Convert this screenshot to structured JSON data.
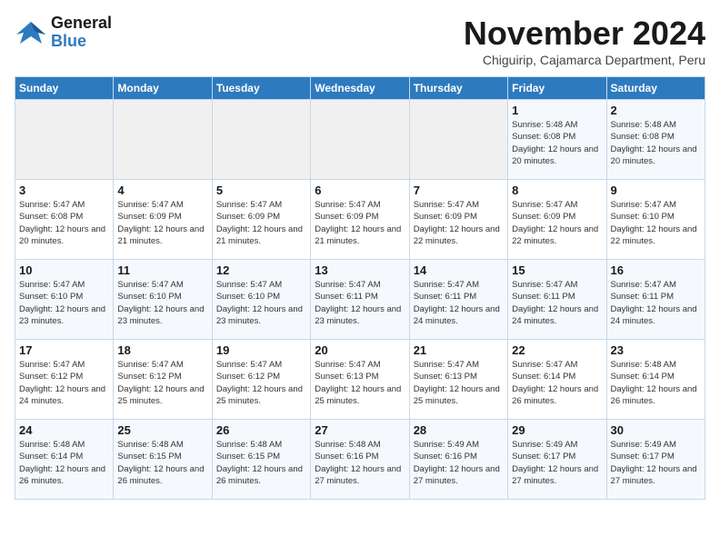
{
  "logo": {
    "line1": "General",
    "line2": "Blue"
  },
  "title": "November 2024",
  "subtitle": "Chiguirip, Cajamarca Department, Peru",
  "days_of_week": [
    "Sunday",
    "Monday",
    "Tuesday",
    "Wednesday",
    "Thursday",
    "Friday",
    "Saturday"
  ],
  "weeks": [
    [
      {
        "day": "",
        "info": ""
      },
      {
        "day": "",
        "info": ""
      },
      {
        "day": "",
        "info": ""
      },
      {
        "day": "",
        "info": ""
      },
      {
        "day": "",
        "info": ""
      },
      {
        "day": "1",
        "info": "Sunrise: 5:48 AM\nSunset: 6:08 PM\nDaylight: 12 hours and 20 minutes."
      },
      {
        "day": "2",
        "info": "Sunrise: 5:48 AM\nSunset: 6:08 PM\nDaylight: 12 hours and 20 minutes."
      }
    ],
    [
      {
        "day": "3",
        "info": "Sunrise: 5:47 AM\nSunset: 6:08 PM\nDaylight: 12 hours and 20 minutes."
      },
      {
        "day": "4",
        "info": "Sunrise: 5:47 AM\nSunset: 6:09 PM\nDaylight: 12 hours and 21 minutes."
      },
      {
        "day": "5",
        "info": "Sunrise: 5:47 AM\nSunset: 6:09 PM\nDaylight: 12 hours and 21 minutes."
      },
      {
        "day": "6",
        "info": "Sunrise: 5:47 AM\nSunset: 6:09 PM\nDaylight: 12 hours and 21 minutes."
      },
      {
        "day": "7",
        "info": "Sunrise: 5:47 AM\nSunset: 6:09 PM\nDaylight: 12 hours and 22 minutes."
      },
      {
        "day": "8",
        "info": "Sunrise: 5:47 AM\nSunset: 6:09 PM\nDaylight: 12 hours and 22 minutes."
      },
      {
        "day": "9",
        "info": "Sunrise: 5:47 AM\nSunset: 6:10 PM\nDaylight: 12 hours and 22 minutes."
      }
    ],
    [
      {
        "day": "10",
        "info": "Sunrise: 5:47 AM\nSunset: 6:10 PM\nDaylight: 12 hours and 23 minutes."
      },
      {
        "day": "11",
        "info": "Sunrise: 5:47 AM\nSunset: 6:10 PM\nDaylight: 12 hours and 23 minutes."
      },
      {
        "day": "12",
        "info": "Sunrise: 5:47 AM\nSunset: 6:10 PM\nDaylight: 12 hours and 23 minutes."
      },
      {
        "day": "13",
        "info": "Sunrise: 5:47 AM\nSunset: 6:11 PM\nDaylight: 12 hours and 23 minutes."
      },
      {
        "day": "14",
        "info": "Sunrise: 5:47 AM\nSunset: 6:11 PM\nDaylight: 12 hours and 24 minutes."
      },
      {
        "day": "15",
        "info": "Sunrise: 5:47 AM\nSunset: 6:11 PM\nDaylight: 12 hours and 24 minutes."
      },
      {
        "day": "16",
        "info": "Sunrise: 5:47 AM\nSunset: 6:11 PM\nDaylight: 12 hours and 24 minutes."
      }
    ],
    [
      {
        "day": "17",
        "info": "Sunrise: 5:47 AM\nSunset: 6:12 PM\nDaylight: 12 hours and 24 minutes."
      },
      {
        "day": "18",
        "info": "Sunrise: 5:47 AM\nSunset: 6:12 PM\nDaylight: 12 hours and 25 minutes."
      },
      {
        "day": "19",
        "info": "Sunrise: 5:47 AM\nSunset: 6:12 PM\nDaylight: 12 hours and 25 minutes."
      },
      {
        "day": "20",
        "info": "Sunrise: 5:47 AM\nSunset: 6:13 PM\nDaylight: 12 hours and 25 minutes."
      },
      {
        "day": "21",
        "info": "Sunrise: 5:47 AM\nSunset: 6:13 PM\nDaylight: 12 hours and 25 minutes."
      },
      {
        "day": "22",
        "info": "Sunrise: 5:47 AM\nSunset: 6:14 PM\nDaylight: 12 hours and 26 minutes."
      },
      {
        "day": "23",
        "info": "Sunrise: 5:48 AM\nSunset: 6:14 PM\nDaylight: 12 hours and 26 minutes."
      }
    ],
    [
      {
        "day": "24",
        "info": "Sunrise: 5:48 AM\nSunset: 6:14 PM\nDaylight: 12 hours and 26 minutes."
      },
      {
        "day": "25",
        "info": "Sunrise: 5:48 AM\nSunset: 6:15 PM\nDaylight: 12 hours and 26 minutes."
      },
      {
        "day": "26",
        "info": "Sunrise: 5:48 AM\nSunset: 6:15 PM\nDaylight: 12 hours and 26 minutes."
      },
      {
        "day": "27",
        "info": "Sunrise: 5:48 AM\nSunset: 6:16 PM\nDaylight: 12 hours and 27 minutes."
      },
      {
        "day": "28",
        "info": "Sunrise: 5:49 AM\nSunset: 6:16 PM\nDaylight: 12 hours and 27 minutes."
      },
      {
        "day": "29",
        "info": "Sunrise: 5:49 AM\nSunset: 6:17 PM\nDaylight: 12 hours and 27 minutes."
      },
      {
        "day": "30",
        "info": "Sunrise: 5:49 AM\nSunset: 6:17 PM\nDaylight: 12 hours and 27 minutes."
      }
    ]
  ]
}
